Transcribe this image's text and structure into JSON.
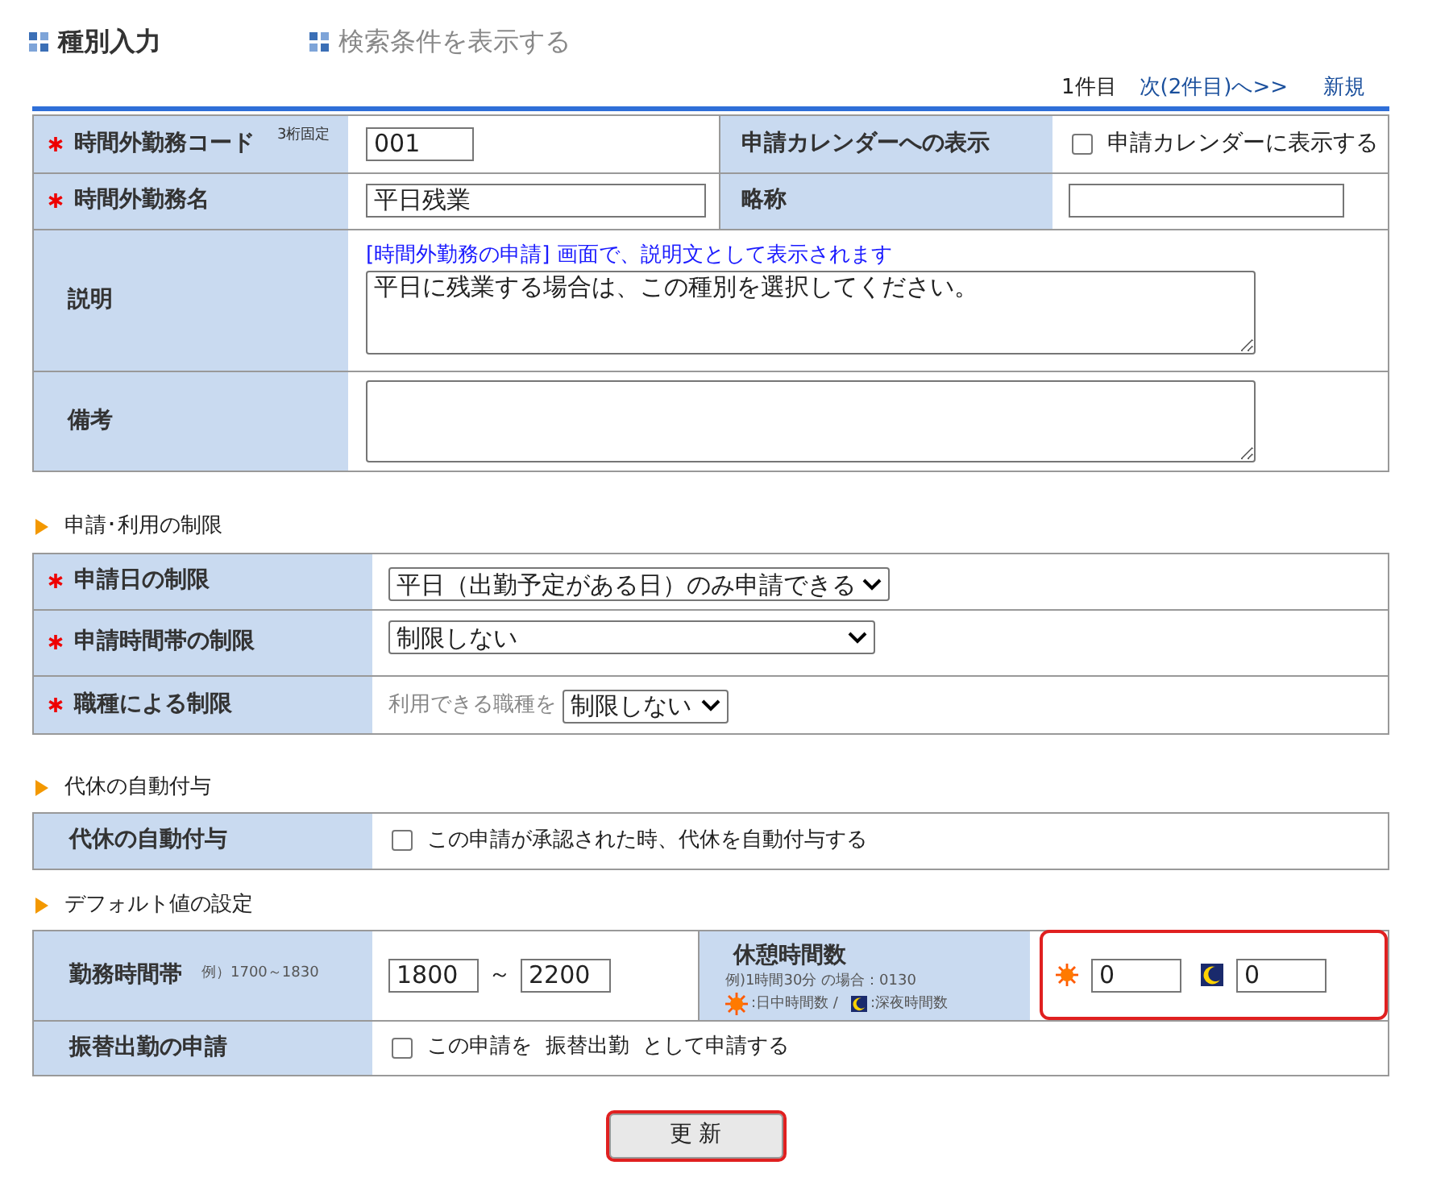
{
  "header": {
    "title": "種別入力",
    "search_link": "検索条件を表示する"
  },
  "pager": {
    "count": "1件目",
    "next": "次(2件目)へ>>",
    "new": "新規"
  },
  "basic": {
    "code": {
      "label": "時間外勤務コード",
      "required": true,
      "hint": "3桁固定",
      "value": "001"
    },
    "calendar": {
      "label": "申請カレンダーへの表示",
      "checkbox_label": "申請カレンダーに表示する",
      "checked": false
    },
    "name": {
      "label": "時間外勤務名",
      "required": true,
      "value": "平日残業"
    },
    "short_name": {
      "label": "略称"
    },
    "description": {
      "label": "説明",
      "note": "[時間外勤務の申請] 画面で、説明文として表示されます",
      "value": "平日に残業する場合は、この種別を選択してください。"
    },
    "remarks": {
      "label": "備考"
    }
  },
  "restrictions": {
    "title": "申請･利用の制限",
    "rows": [
      {
        "kind": "select",
        "label": "申請日の制限",
        "required": true,
        "value": "平日（出勤予定がある日）のみ申請できる"
      },
      {
        "kind": "wide-select",
        "label": "申請時間帯の制限",
        "required": true,
        "value": "制限しない"
      },
      {
        "kind": "prefixed-select",
        "label": "職種による制限",
        "required": true,
        "prefix": "利用できる職種を",
        "value": "制限しない"
      }
    ]
  },
  "substitute": {
    "title": "代休の自動付与",
    "label": "代休の自動付与",
    "checkbox_label": "この申請が承認された時、代休を自動付与する",
    "checked": false
  },
  "defaults": {
    "title": "デフォルト値の設定",
    "work_hours": {
      "label": "勤務時間帯",
      "hint": "例）1700～1830",
      "from": "1800",
      "separator": "～",
      "to": "2200"
    },
    "break": {
      "label": "休憩時間数",
      "hint": "例)1時間30分 の場合：0130",
      "legend_day": ":日中時間数 /",
      "legend_night": ":深夜時間数",
      "day": "0",
      "night": "0"
    },
    "transfer": {
      "label": "振替出勤の申請",
      "checkbox_label": "この申請を  振替出勤  として申請する",
      "checked": false
    }
  },
  "submit": "更 新"
}
